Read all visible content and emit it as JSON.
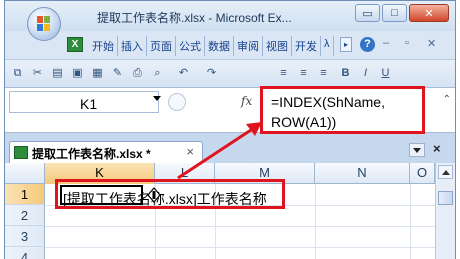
{
  "window": {
    "title": "提取工作表名称.xlsx - Microsoft Ex...",
    "buttons": {
      "minimize": "▭",
      "maximize": "□",
      "close": "✕"
    }
  },
  "ribbon": {
    "tabs": [
      "开始",
      "插入",
      "页面",
      "公式",
      "数据",
      "审阅",
      "视图",
      "开发",
      "λ"
    ],
    "more": "▸",
    "help": "?",
    "doc_controls": [
      "–",
      "▫",
      "✕"
    ]
  },
  "toolbar": {
    "icons": [
      "copy-icon",
      "cut-icon",
      "paste-icon",
      "save-icon",
      "chart-icon",
      "brush-icon",
      "print-icon",
      "search-icon",
      "undo-icon",
      "redo-icon",
      "align-left-icon",
      "align-center-icon",
      "align-right-icon",
      "bold-icon",
      "italic-icon",
      "underline-icon"
    ],
    "labels": [
      "⧉",
      "✂",
      "▤",
      "▣",
      "▦",
      "✎",
      "⎙",
      "⌕",
      "↶",
      "↷",
      "≡",
      "≡",
      "≡",
      "B",
      "I",
      "U"
    ]
  },
  "formula_bar": {
    "name_box": "K1",
    "fx": "fx",
    "formula_line1": "=INDEX(ShName,",
    "formula_line2": "ROW(A1))",
    "scroll": "⌃"
  },
  "workbook": {
    "tab_label": "提取工作表名称.xlsx *",
    "tab_close": "×",
    "close_x": "×"
  },
  "grid": {
    "columns": [
      "K",
      "L",
      "M",
      "N",
      "O"
    ],
    "rows": [
      "1",
      "2",
      "3",
      "4"
    ],
    "selected_column": "K",
    "selected_row": "1",
    "cell_k1_value": "[提取工作表名称.xlsx]工作表名称"
  },
  "colors": {
    "highlight": "#e0141e",
    "accent": "#15428b"
  }
}
